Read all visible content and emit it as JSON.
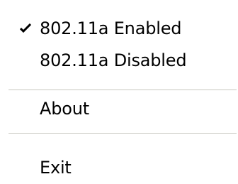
{
  "menu": {
    "items": [
      {
        "label": "802.11a Enabled",
        "checked": true
      },
      {
        "label": "802.11a Disabled",
        "checked": false
      },
      {
        "label": "About",
        "checked": false
      },
      {
        "label": "Exit",
        "checked": false
      }
    ],
    "check_icon": "checkmark-icon",
    "text_color": "#000000",
    "separator_color": "#c7c7bf"
  }
}
